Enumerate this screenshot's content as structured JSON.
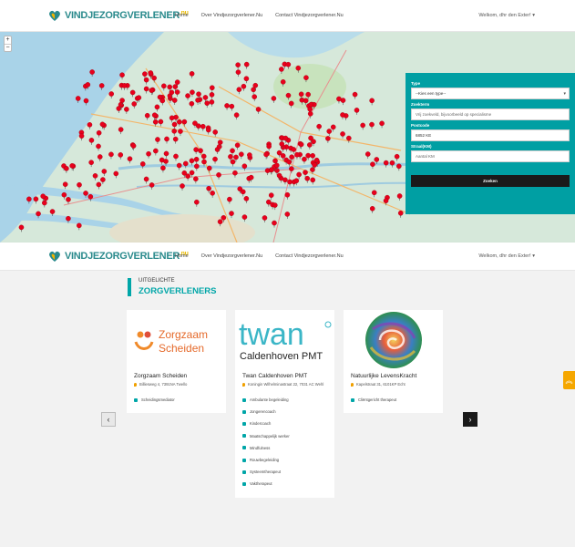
{
  "brand": {
    "name": "VINDJEZORGVERLENER",
    "tail": ".nu",
    "colors": {
      "teal": "#00a6a8",
      "yellow": "#e8b800",
      "dark": "#1a1a1a",
      "pin": "#e8001c"
    }
  },
  "nav": {
    "items": [
      "Home",
      "Over Vindjezorgverlener.Nu",
      "Contact Vindjezorgverlener.Nu"
    ],
    "user": "Welkom, dhr den Exter! ▾"
  },
  "map": {
    "zoom_in": "+",
    "zoom_out": "−",
    "pins_visible": true
  },
  "search": {
    "type_label": "Type",
    "type_value": "--Kies een type--",
    "term_label": "Zoekterm",
    "term_placeholder": "Vrij zoekveld, bijvoorbeeld op specialisme",
    "postcode_label": "Postcode",
    "postcode_value": "6852 KE",
    "straal_label": "Straal(KM)",
    "straal_placeholder": "Aantal KM",
    "button": "Zoeken"
  },
  "featured": {
    "small": "UITGELICHTE",
    "big": "ZORGVERLENERS",
    "cards": [
      {
        "logo_line1": "Zorgzaam",
        "logo_line2": "Scheiden",
        "title": "Zorgzaam Scheiden",
        "address": "Billiesweg 4, 7391NA Twello",
        "services": [
          "Scheidingsmediator"
        ]
      },
      {
        "logo_line1": "twan",
        "logo_line2": "Caldenhoven PMT",
        "title": "Twan Caldenhoven PMT",
        "address": "Koningin Wilhelminastraat 22, 7031 AC Wehl",
        "services": [
          "Ambulante begeleiding",
          "Jongerencoach",
          "Kindercoach",
          "Maatschappelijk werker",
          "Mindfulness",
          "Rouwbegeleiding",
          "Systeemtherapeut",
          "Vaktherapeut"
        ]
      },
      {
        "title": "Natuurlijke LevensKracht",
        "address": "Kapelstraat 31, 6101KP Echt",
        "services": [
          "Cliëntgericht therapeut"
        ]
      }
    ],
    "prev": "‹",
    "next": "›"
  },
  "scroll_top": "︽"
}
